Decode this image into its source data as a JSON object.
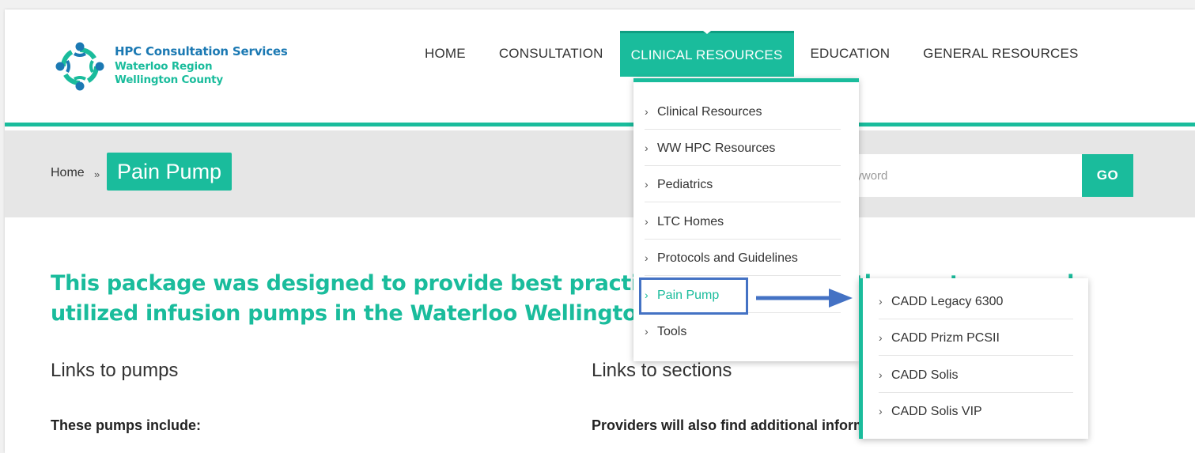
{
  "logo": {
    "line1": "HPC Consultation Services",
    "line2": "Waterloo Region",
    "line3": "Wellington County",
    "icon": "people-circle-logo-icon"
  },
  "nav": {
    "items": [
      "HOME",
      "CONSULTATION",
      "CLINICAL RESOURCES",
      "EDUCATION",
      "GENERAL RESOURCES"
    ],
    "active": "CLINICAL RESOURCES"
  },
  "breadcrumb": {
    "home": "Home",
    "separator": "»",
    "current": "Pain Pump"
  },
  "search": {
    "placeholder": "Enter Keyword",
    "button": "GO"
  },
  "content": {
    "intro_line1": "This package was designed to provide best practice information on the most commonly",
    "intro_line2": "utilized infusion pumps in the Waterloo Wellington LHIN.",
    "left_heading": "Links to pumps",
    "right_heading": "Links to sections",
    "left_sub": "These pumps include:",
    "right_sub": "Providers will also find additional information"
  },
  "dropdown": {
    "items": [
      "Clinical Resources",
      "WW HPC Resources",
      "Pediatrics",
      "LTC Homes",
      "Protocols and Guidelines",
      "Pain Pump",
      "Tools"
    ],
    "highlighted": "Pain Pump"
  },
  "submenu": {
    "items": [
      "CADD Legacy 6300",
      "CADD Prizm PCSII",
      "CADD Solis",
      "CADD Solis VIP"
    ]
  },
  "colors": {
    "accent": "#1abc9c",
    "brand_blue": "#1b79b3",
    "annotation": "#4472c4"
  }
}
